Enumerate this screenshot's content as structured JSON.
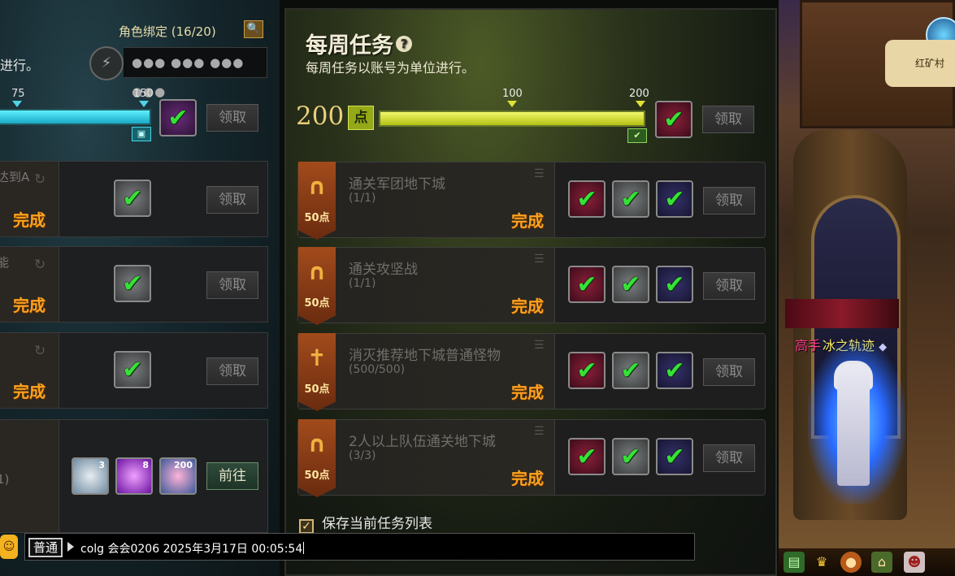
{
  "daily": {
    "bind_label": "角色绑定 (16/20)",
    "subtitle": "进行。",
    "password_mask": "●●● ●●● ●●● ●●●",
    "milestones": [
      "75",
      "150"
    ],
    "progress_fraction": 1.0,
    "claim_label": "领取",
    "rows": [
      {
        "snippet": "达到A",
        "status": "完成",
        "claim": "领取"
      },
      {
        "snippet": "能",
        "status": "完成",
        "claim": "领取"
      },
      {
        "snippet": "",
        "status": "完成",
        "claim": "领取"
      },
      {
        "snippet": "1)",
        "rewards": [
          {
            "count": "3"
          },
          {
            "count": "8"
          },
          {
            "count": "200"
          }
        ],
        "goto": "前往"
      }
    ]
  },
  "weekly": {
    "title": "每周任务",
    "help_icon": "?",
    "subtitle": "每周任务以账号为单位进行。",
    "points": "200",
    "points_unit": "点",
    "milestones": [
      "100",
      "200"
    ],
    "progress_fraction": 1.0,
    "claim_label": "领取",
    "tasks": [
      {
        "name": "通关军团地下城",
        "progress": "(1/1)",
        "points": "50点",
        "status": "完成",
        "claim": "领取"
      },
      {
        "name": "通关攻坚战",
        "progress": "(1/1)",
        "points": "50点",
        "status": "完成",
        "claim": "领取"
      },
      {
        "name": "消灭推荐地下城普通怪物",
        "progress": "(500/500)",
        "points": "50点",
        "status": "完成",
        "claim": "领取"
      },
      {
        "name": "2人以上队伍通关地下城",
        "progress": "(3/3)",
        "points": "50点",
        "status": "完成",
        "claim": "领取"
      }
    ],
    "save_label": "保存当前任务列表"
  },
  "chat": {
    "channel": "普通",
    "message": "colg 会会0206 2025年3月17日 00:05:54"
  },
  "scene": {
    "map_name": "红矿村",
    "player_rank": "高手",
    "player_name": "冰之轨迹"
  },
  "colors": {
    "accent_orange": "#ffa21e",
    "check_green": "#36e236",
    "bar_yellow": "#e0e23a",
    "bar_cyan": "#4fd3e8"
  }
}
